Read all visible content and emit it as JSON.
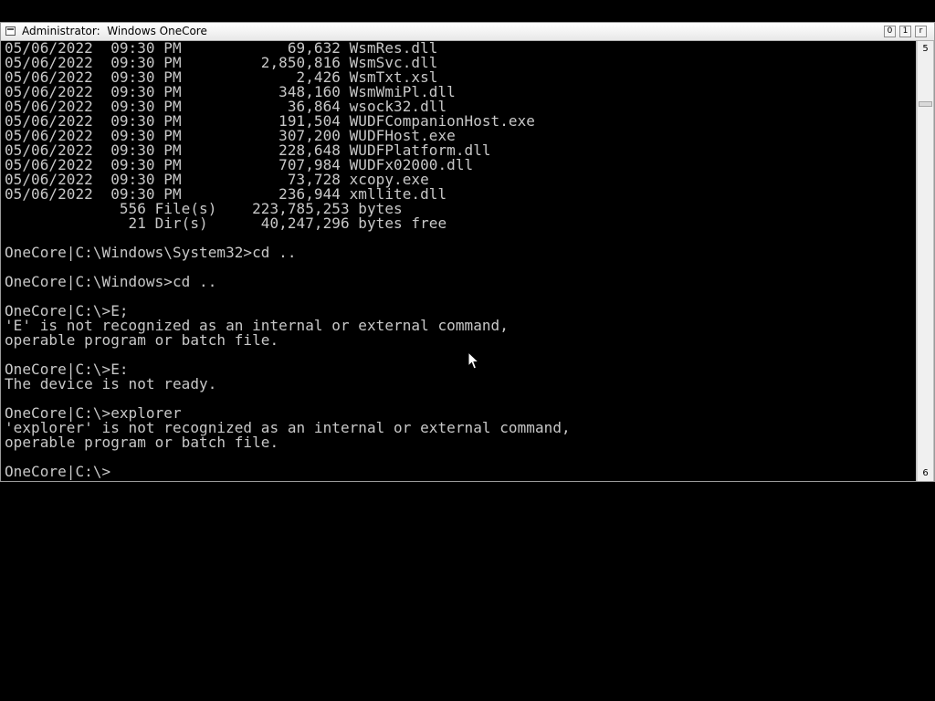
{
  "window": {
    "title": "Administrator:  Windows OneCore",
    "buttons": {
      "minimize": "0",
      "maximize": "1",
      "close": "r"
    }
  },
  "scrollbar": {
    "up_glyph": "5",
    "down_glyph": "6"
  },
  "console": {
    "lines": [
      "05/06/2022  09:30 PM            69,632 WsmRes.dll",
      "05/06/2022  09:30 PM         2,850,816 WsmSvc.dll",
      "05/06/2022  09:30 PM             2,426 WsmTxt.xsl",
      "05/06/2022  09:30 PM           348,160 WsmWmiPl.dll",
      "05/06/2022  09:30 PM            36,864 wsock32.dll",
      "05/06/2022  09:30 PM           191,504 WUDFCompanionHost.exe",
      "05/06/2022  09:30 PM           307,200 WUDFHost.exe",
      "05/06/2022  09:30 PM           228,648 WUDFPlatform.dll",
      "05/06/2022  09:30 PM           707,984 WUDFx02000.dll",
      "05/06/2022  09:30 PM            73,728 xcopy.exe",
      "05/06/2022  09:30 PM           236,944 xmllite.dll",
      "             556 File(s)    223,785,253 bytes",
      "              21 Dir(s)      40,247,296 bytes free",
      "",
      "OneCore|C:\\Windows\\System32>cd ..",
      "",
      "OneCore|C:\\Windows>cd ..",
      "",
      "OneCore|C:\\>E;",
      "'E' is not recognized as an internal or external command,",
      "operable program or batch file.",
      "",
      "OneCore|C:\\>E:",
      "The device is not ready.",
      "",
      "OneCore|C:\\>explorer",
      "'explorer' is not recognized as an internal or external command,",
      "operable program or batch file.",
      "",
      "OneCore|C:\\>"
    ]
  }
}
